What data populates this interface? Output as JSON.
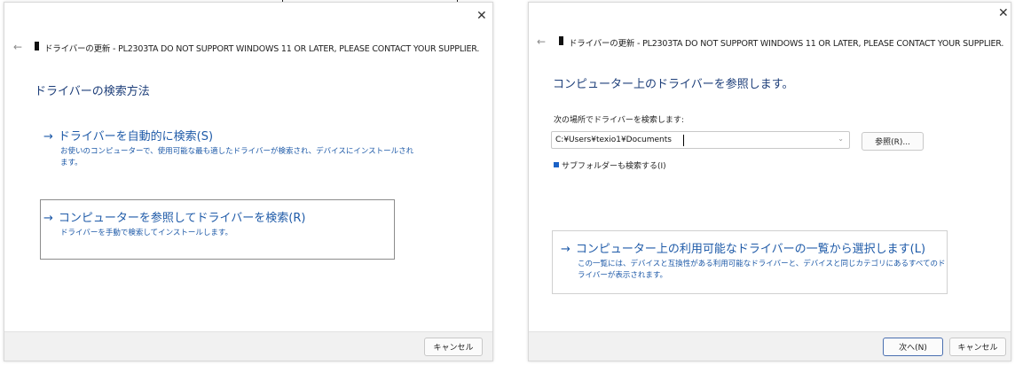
{
  "title": "ドライバーの更新 - PL2303TA DO NOT SUPPORT WINDOWS 11 OR LATER, PLEASE CONTACT YOUR SUPPLIER.",
  "left": {
    "heading": "ドライバーの検索方法",
    "auto_search": {
      "label": "ドライバーを自動的に検索(S)",
      "description_1": "お使いのコンピューターで、使用可能な最も適したドライバーが検索され、デバイスにインストールされ",
      "description_2": "ます。"
    },
    "browse": {
      "label": "コンピューターを参照してドライバーを検索(R)",
      "description": "ドライバーを手動で検索してインストールします。"
    },
    "cancel_label": "キャンセル"
  },
  "right": {
    "heading": "コンピューター上のドライバーを参照します。",
    "search_location_label": "次の場所でドライバーを検索します:",
    "path_value": "C:¥Users¥texio1¥Documents",
    "browse_button_label": "参照(R)...",
    "include_subfolders_label": "サブフォルダーも検索する(I)",
    "pick_list": {
      "label": "コンピューター上の利用可能なドライバーの一覧から選択します(L)",
      "description_1": "この一覧には、デバイスと互換性がある利用可能なドライバーと、デバイスと同じカテゴリにあるすべてのド",
      "description_2": "ライバーが表示されます。"
    },
    "next_label": "次へ(N)",
    "cancel_label": "キャンセル"
  },
  "icons": {
    "close": "close-icon",
    "back": "back-arrow-icon",
    "device": "device-icon",
    "link_arrow": "arrow-right-icon"
  },
  "colors": {
    "link": "#1e5aa8",
    "heading": "#1e3f7a",
    "footer": "#f1f1f1",
    "checkbox": "#1b62c7"
  }
}
